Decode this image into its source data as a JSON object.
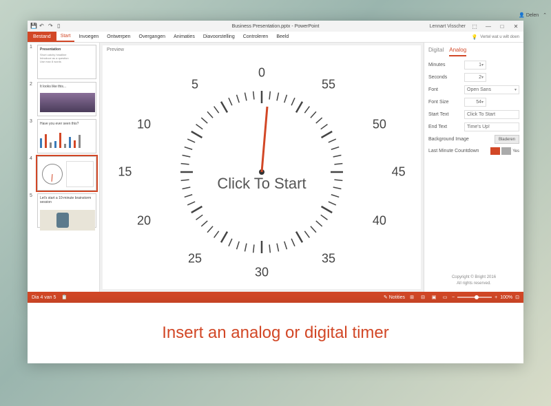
{
  "titlebar": {
    "title": "Business Presentation.pptx - PowerPoint",
    "user": "Lennart Visscher"
  },
  "ribbon": {
    "file": "Bestand",
    "tabs": [
      "Start",
      "Invoegen",
      "Ontwerpen",
      "Overgangen",
      "Animaties",
      "Diavoorstelling",
      "Controleren",
      "Beeld"
    ],
    "tell_me": "Vertel wat u wilt doen",
    "share": "Delen"
  },
  "thumbs": {
    "t1_title": "Presentation",
    "t2_title": "It looks like this...",
    "t3_title": "Have you ever seen this?",
    "t5_title": "Let's start a 10-minute brainstorm session"
  },
  "preview": {
    "label": "Preview",
    "center_text": "Click To Start",
    "numbers": {
      "n0": "0",
      "n5": "5",
      "n10": "10",
      "n15": "15",
      "n20": "20",
      "n25": "25",
      "n30": "30",
      "n35": "35",
      "n40": "40",
      "n45": "45",
      "n50": "50",
      "n55": "55"
    }
  },
  "panel": {
    "tabs": {
      "digital": "Digital",
      "analog": "Analog"
    },
    "minutes_label": "Minutes",
    "minutes_value": "1",
    "seconds_label": "Seconds",
    "seconds_value": "2",
    "font_label": "Font",
    "font_value": "Open Sans",
    "fontsize_label": "Font Size",
    "fontsize_value": "54",
    "starttext_label": "Start Text",
    "starttext_value": "Click To Start",
    "endtext_label": "End Text",
    "endtext_value": "Time's Up!",
    "bg_label": "Background Image",
    "browse": "Bladeren",
    "countdown_label": "Last Minute Countdown",
    "countdown_yes": "Yes",
    "copyright": "Copyright © Bright 2016",
    "rights": "All rights reserved."
  },
  "statusbar": {
    "slide_info": "Dia 4 van 5",
    "notes": "Notities",
    "zoom": "100%"
  },
  "caption": "Insert an analog or digital timer"
}
